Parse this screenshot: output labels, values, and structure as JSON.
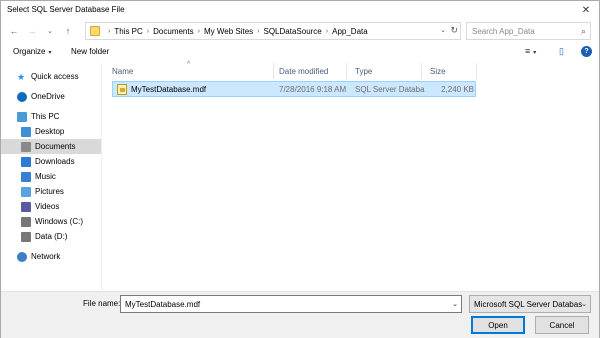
{
  "window": {
    "title": "Select SQL Server Database File",
    "close_glyph": "✕"
  },
  "nav": {
    "back_glyph": "←",
    "forward_glyph": "→",
    "history_glyph": "⌄",
    "up_glyph": "↑",
    "breadcrumbs": [
      "This PC",
      "Documents",
      "My Web Sites",
      "SQLDataSource",
      "App_Data"
    ],
    "crumb_separator": "›",
    "address_dropdown_glyph": "⌄",
    "refresh_glyph": "↻",
    "search_placeholder": "Search App_Data",
    "search_glyph": "⌕"
  },
  "toolbar": {
    "organize_label": "Organize",
    "new_folder_label": "New folder",
    "help_glyph": "?",
    "view_glyph": "≡",
    "caret_glyph": "▾",
    "pane_glyph": "▯"
  },
  "sidebar": {
    "items": [
      {
        "label": "Quick access",
        "icon": "star-icon",
        "color": "#1e90ff"
      },
      {
        "label": "OneDrive",
        "icon": "cloud-icon",
        "color": "#0f6cbd"
      },
      {
        "label": "This PC",
        "icon": "computer-icon",
        "color": "#4b9cd3"
      },
      {
        "label": "Desktop",
        "icon": "desktop-icon",
        "color": "#3b8fd6"
      },
      {
        "label": "Documents",
        "icon": "documents-icon",
        "color": "#8a8a8a",
        "selected": true
      },
      {
        "label": "Downloads",
        "icon": "download-icon",
        "color": "#2b7bd3"
      },
      {
        "label": "Music",
        "icon": "music-icon",
        "color": "#3a7fd0"
      },
      {
        "label": "Pictures",
        "icon": "pictures-icon",
        "color": "#5ba3e0"
      },
      {
        "label": "Videos",
        "icon": "videos-icon",
        "color": "#5a5a9e"
      },
      {
        "label": "Windows (C:)",
        "icon": "drive-icon",
        "color": "#777777"
      },
      {
        "label": "Data (D:)",
        "icon": "drive-icon",
        "color": "#777777"
      },
      {
        "label": "Network",
        "icon": "network-icon",
        "color": "#3b7fc4"
      }
    ]
  },
  "filelist": {
    "columns": [
      "Name",
      "Date modified",
      "Type",
      "Size"
    ],
    "sort_glyph": "^",
    "rows": [
      {
        "name": "MyTestDatabase.mdf",
        "date": "7/28/2016 9:18 AM",
        "type": "SQL Server Databa...",
        "size": "2,240 KB",
        "selected": true
      }
    ]
  },
  "footer": {
    "file_name_label": "File name:",
    "file_name_value": "MyTestDatabase.mdf",
    "dropdown_glyph": "⌄",
    "filter_value": "Microsoft SQL Server Databases",
    "open_label": "Open",
    "cancel_label": "Cancel"
  },
  "colors": {
    "selection_fill": "#cce8ff",
    "selection_border": "#99d1ff",
    "nav_selected": "#d9d9d9",
    "column_header_text": "#4c607a",
    "default_button_border": "#0078d7"
  }
}
